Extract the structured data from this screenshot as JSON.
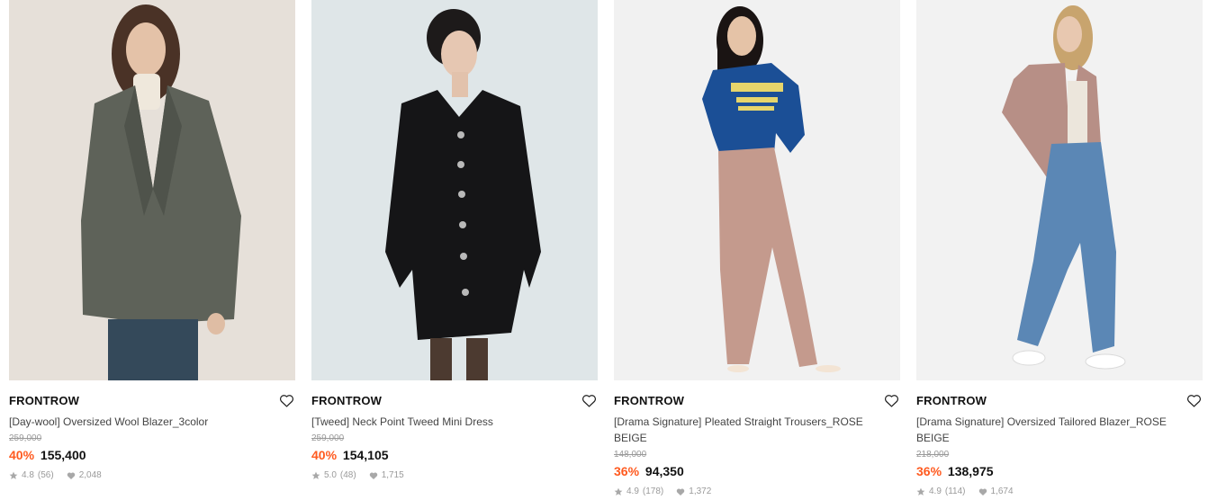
{
  "products": [
    {
      "brand": "FRONTROW",
      "title": "[Day-wool] Oversized Wool Blazer_3color",
      "original_price": "259,000",
      "discount": "40%",
      "price": "155,400",
      "rating": "4.8",
      "reviews": "(56)",
      "likes": "2,048",
      "image_bg": "#e9e4de"
    },
    {
      "brand": "FRONTROW",
      "title": "[Tweed] Neck Point Tweed Mini Dress",
      "original_price": "259,000",
      "discount": "40%",
      "price": "154,105",
      "rating": "5.0",
      "reviews": "(48)",
      "likes": "1,715",
      "image_bg": "#dfe6e8"
    },
    {
      "brand": "FRONTROW",
      "title": "[Drama Signature] Pleated Straight Trousers_ROSE BEIGE",
      "original_price": "148,000",
      "discount": "36%",
      "price": "94,350",
      "rating": "4.9",
      "reviews": "(178)",
      "likes": "1,372",
      "image_bg": "#f1f1f1"
    },
    {
      "brand": "FRONTROW",
      "title": "[Drama Signature] Oversized Tailored Blazer_ROSE BEIGE",
      "original_price": "218,000",
      "discount": "36%",
      "price": "138,975",
      "rating": "4.9",
      "reviews": "(114)",
      "likes": "1,674",
      "image_bg": "#f2f2f2"
    }
  ],
  "icons": {
    "wishlist": "heart-outline-icon",
    "rating": "star-icon",
    "likes": "heart-filled-icon"
  },
  "colors": {
    "discount": "#ff5a1f",
    "meta": "#9a9a9a"
  }
}
